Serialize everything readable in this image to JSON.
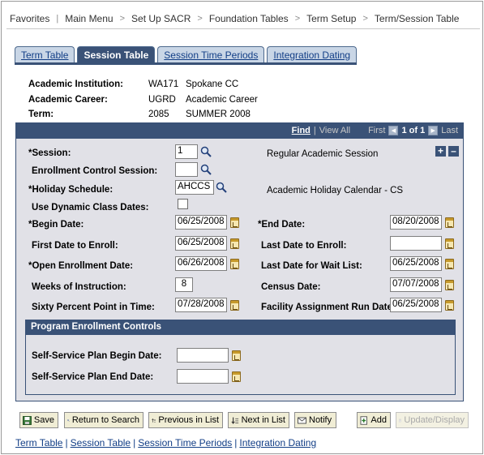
{
  "breadcrumb": [
    "Favorites",
    "Main Menu",
    "Set Up SACR",
    "Foundation Tables",
    "Term Setup",
    "Term/Session Table"
  ],
  "tabs": [
    {
      "label": "Term Table",
      "active": false
    },
    {
      "label": "Session Table",
      "active": true
    },
    {
      "label": "Session Time Periods",
      "active": false
    },
    {
      "label": "Integration Dating",
      "active": false
    }
  ],
  "header": {
    "institution_label": "Academic Institution:",
    "institution_code": "WA171",
    "institution_name": "Spokane CC",
    "career_label": "Academic Career:",
    "career_code": "UGRD",
    "career_name": "Academic Career",
    "term_label": "Term:",
    "term_code": "2085",
    "term_name": "SUMMER 2008"
  },
  "nav": {
    "find": "Find",
    "view_all": "View All",
    "first": "First",
    "counter": "1 of 1",
    "last": "Last"
  },
  "form": {
    "session_label": "*Session:",
    "session_value": "1",
    "session_desc": "Regular Academic Session",
    "enroll_control_label": "Enrollment Control Session:",
    "enroll_control_value": "",
    "holiday_label": "*Holiday Schedule:",
    "holiday_value": "AHCCS",
    "holiday_desc": "Academic Holiday Calendar - CS",
    "dynamic_label": "Use Dynamic Class Dates:",
    "begin_label": "*Begin Date:",
    "begin_value": "06/25/2008",
    "end_label": "*End Date:",
    "end_value": "08/20/2008",
    "first_enroll_label": "First Date to Enroll:",
    "first_enroll_value": "06/25/2008",
    "last_enroll_label": "Last Date to Enroll:",
    "last_enroll_value": "",
    "open_enroll_label": "*Open Enrollment Date:",
    "open_enroll_value": "06/26/2008",
    "waitlist_label": "Last Date for Wait List:",
    "waitlist_value": "06/25/2008",
    "weeks_label": "Weeks of Instruction:",
    "weeks_value": "8",
    "census_label": "Census Date:",
    "census_value": "07/07/2008",
    "sixty_label": "Sixty Percent Point in Time:",
    "sixty_value": "07/28/2008",
    "facility_label": "Facility Assignment Run Date:",
    "facility_value": "06/25/2008"
  },
  "program": {
    "title": "Program Enrollment Controls",
    "plan_begin_label": "Self-Service Plan Begin Date:",
    "plan_begin_value": "",
    "plan_end_label": "Self-Service Plan End Date:",
    "plan_end_value": ""
  },
  "toolbar": {
    "save": "Save",
    "return": "Return to Search",
    "previous": "Previous in List",
    "next": "Next in List",
    "notify": "Notify",
    "add": "Add",
    "update": "Update/Display"
  },
  "links": [
    "Term Table",
    "Session Table",
    "Session Time Periods",
    "Integration Dating"
  ]
}
